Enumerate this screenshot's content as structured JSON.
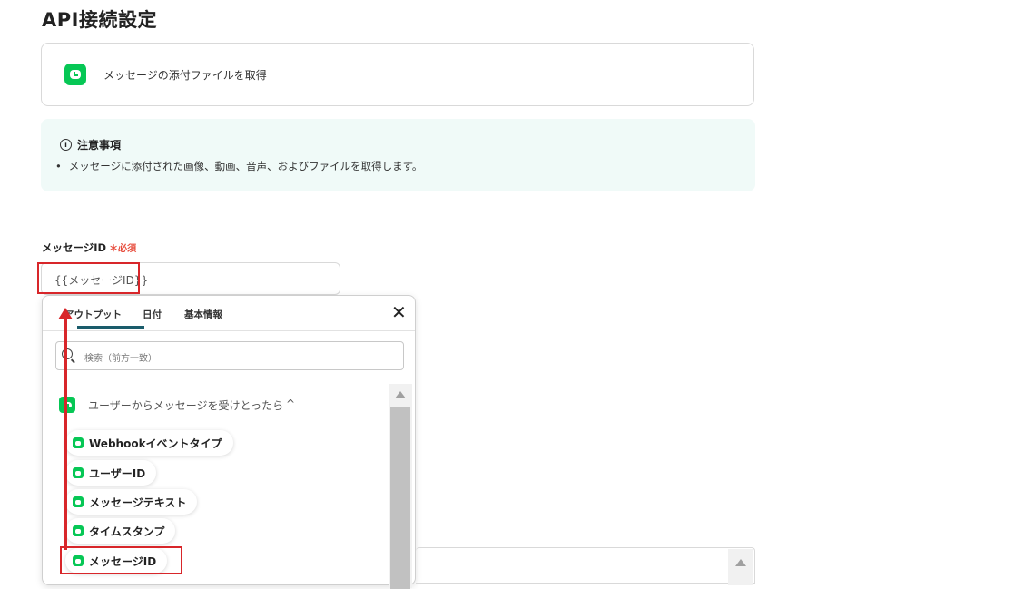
{
  "page": {
    "title": "API接続設定"
  },
  "action": {
    "label": "メッセージの添付ファイルを取得",
    "icon": "line-icon"
  },
  "notice": {
    "title": "注意事項",
    "items": [
      "メッセージに添付された画像、動画、音声、およびファイルを取得します。"
    ]
  },
  "field": {
    "label": "メッセージID",
    "required_mark": "＊",
    "required_label": "必須",
    "value": "{{メッセージID}}"
  },
  "dropdown": {
    "tabs": [
      {
        "label": "アウトプット",
        "active": true
      },
      {
        "label": "日付",
        "active": false
      },
      {
        "label": "基本情報",
        "active": false
      }
    ],
    "search_placeholder": "検索（前方一致）",
    "group": {
      "label": "ユーザーからメッセージを受けとったら",
      "chevron": "^"
    },
    "items": [
      {
        "label": "Webhookイベントタイプ"
      },
      {
        "label": "ユーザーID"
      },
      {
        "label": "メッセージテキスト"
      },
      {
        "label": "タイムスタンプ"
      },
      {
        "label": "メッセージID"
      }
    ]
  },
  "colors": {
    "brand_line": "#06c755",
    "annotation_red": "#d8262a",
    "notice_bg": "#f0faf8",
    "tab_accent": "#1a5c6b"
  }
}
